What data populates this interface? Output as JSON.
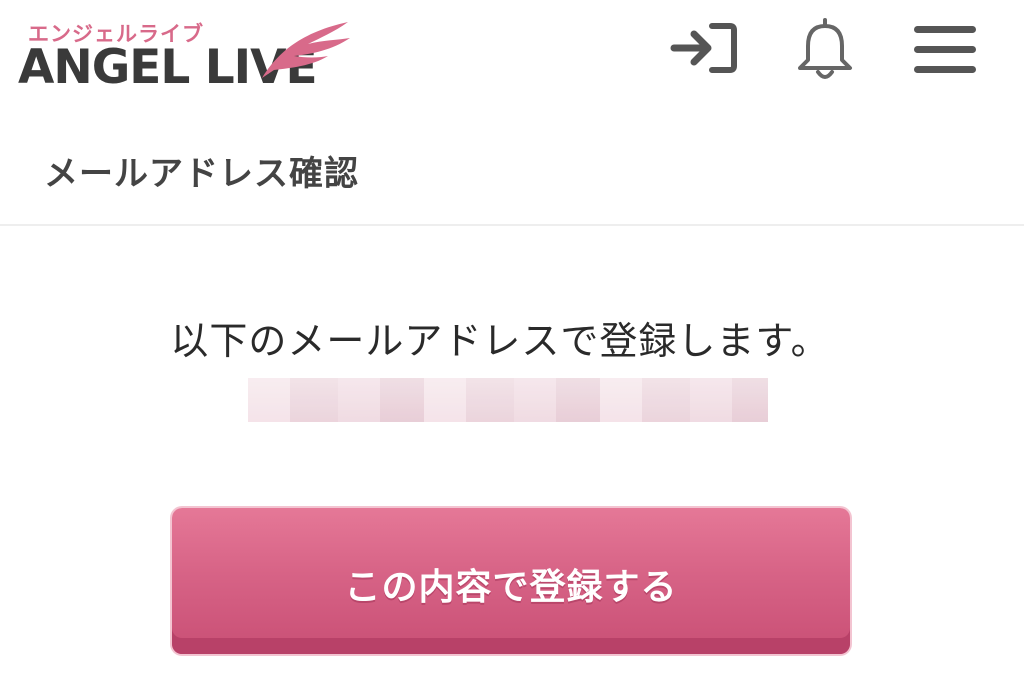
{
  "header": {
    "logo_kana": "エンジェルライブ",
    "logo_text": "ANGEL LIVE",
    "icons": [
      "login-icon",
      "bell-icon",
      "hamburger-menu-icon"
    ]
  },
  "page": {
    "title": "メールアドレス確認",
    "message": "以下のメールアドレスで登録します。",
    "email_value": ""
  },
  "actions": {
    "submit_label": "この内容で登録する"
  },
  "colors": {
    "brand_pink": "#d76386",
    "logo_gray": "#3a3a3a",
    "text_dark": "#333333"
  }
}
